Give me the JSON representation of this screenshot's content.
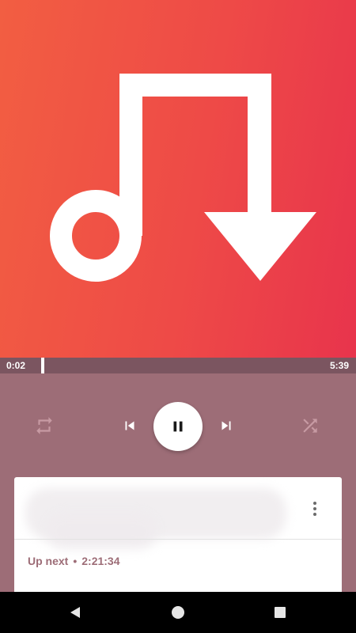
{
  "player": {
    "elapsed": "0:02",
    "duration": "5:39",
    "progress_fraction": 0.006
  },
  "queue": {
    "track_title": "",
    "track_subtitle": "",
    "up_next_label": "Up next",
    "separator": "•",
    "up_next_duration": "2:21:34"
  },
  "icons": {
    "artwork": "music-note-download-icon",
    "repeat": "repeat-icon",
    "prev": "skip-previous-icon",
    "play_pause": "pause-icon",
    "next": "skip-next-icon",
    "shuffle": "shuffle-icon",
    "more": "more-vert-icon",
    "nav_back": "back-triangle-icon",
    "nav_home": "home-circle-icon",
    "nav_recents": "recents-square-icon"
  },
  "colors": {
    "artwork_start": "#f25e42",
    "artwork_end": "#e8344c",
    "accent": "#9d6d77",
    "seek_bar": "#7b5560"
  }
}
